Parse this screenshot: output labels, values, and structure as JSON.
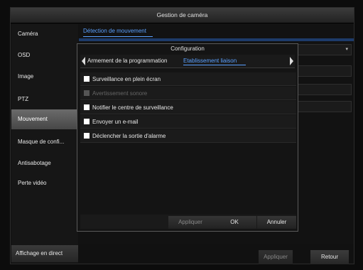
{
  "window": {
    "title": "Gestion de caméra"
  },
  "sidebar": {
    "items": [
      {
        "label": "Caméra"
      },
      {
        "label": "OSD"
      },
      {
        "label": "Image"
      },
      {
        "label": "PTZ"
      },
      {
        "label": "Mouvement",
        "active": true
      },
      {
        "label": "Masque de confi..."
      },
      {
        "label": "Antisabotage"
      },
      {
        "label": "Perte vidéo"
      }
    ],
    "live_view_label": "Affichage en direct"
  },
  "main": {
    "tab_label": "Détection de mouvement"
  },
  "footer": {
    "apply_label": "Appliquer",
    "back_label": "Retour"
  },
  "dialog": {
    "title": "Configuration",
    "tabs": [
      {
        "label": "Armement de la programmation",
        "active": false
      },
      {
        "label": "Etablissement liaison",
        "active": true
      }
    ],
    "options": [
      {
        "label": "Surveillance en plein écran",
        "enabled": true
      },
      {
        "label": "Avertissement sonore",
        "enabled": false
      },
      {
        "label": "Notifier le centre de surveillance",
        "enabled": true
      },
      {
        "label": "Envoyer un e-mail",
        "enabled": true
      },
      {
        "label": "Déclencher la sortie d'alarme",
        "enabled": true
      }
    ],
    "buttons": {
      "apply_label": "Appliquer",
      "ok_label": "OK",
      "cancel_label": "Annuler"
    }
  },
  "colors": {
    "accent": "#5aa0ff",
    "active_item": "#5a5a5a",
    "background": "#121212"
  }
}
